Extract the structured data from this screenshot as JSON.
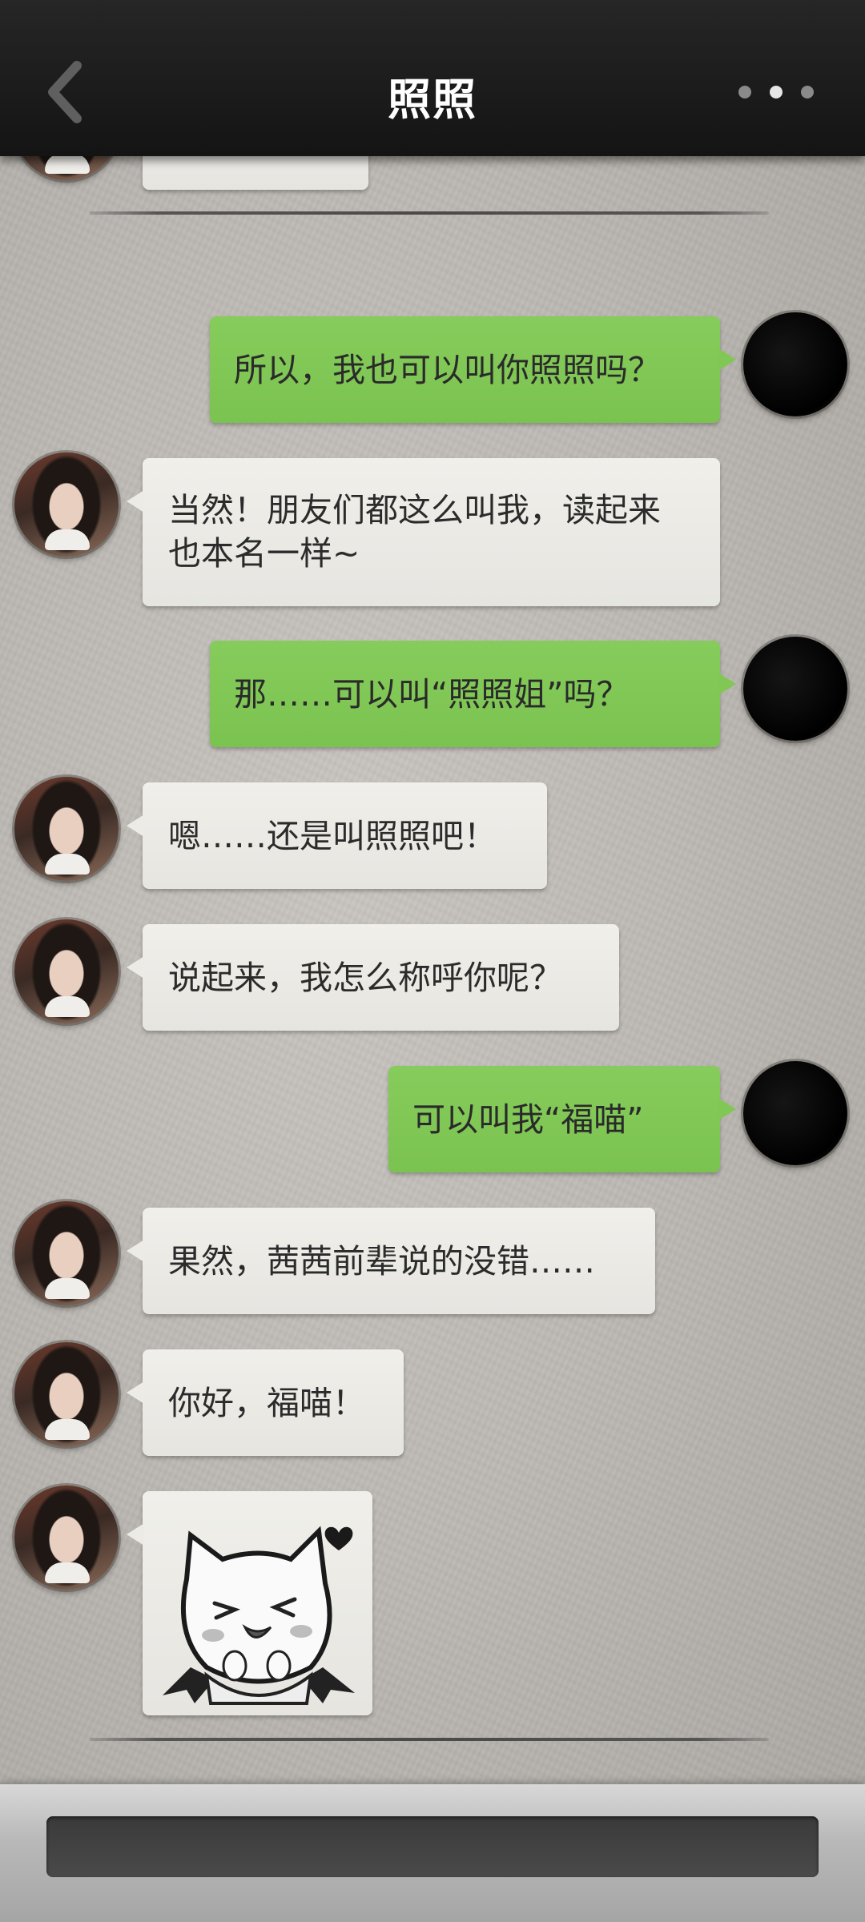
{
  "header": {
    "title": "照照",
    "back_icon": "chevron-left-icon",
    "more_icon": "more-dots-icon"
  },
  "messages": [
    {
      "sender": "her",
      "text": "",
      "partial": true
    },
    {
      "sender": "me",
      "text": "所以，我也可以叫你照照吗？"
    },
    {
      "sender": "her",
      "lines": [
        "当然！朋友们都这么叫我，读起来",
        "也本名一样~"
      ]
    },
    {
      "sender": "me",
      "text": "那……可以叫“照照姐”吗？"
    },
    {
      "sender": "her",
      "text": "嗯……还是叫照照吧！"
    },
    {
      "sender": "her",
      "text": "说起来，我怎么称呼你呢？"
    },
    {
      "sender": "me",
      "text": "可以叫我“福喵”"
    },
    {
      "sender": "her",
      "text": "果然，茜茜前辈说的没错……"
    },
    {
      "sender": "her",
      "text": "你好，福喵！"
    },
    {
      "sender": "her",
      "type": "sticker",
      "sticker": "winking-bat-cat-sticker"
    }
  ],
  "input": {
    "value": "",
    "placeholder": ""
  },
  "colors": {
    "header_bg": "#1c1c1c",
    "my_bubble": "#80c756",
    "her_bubble": "#ecebe6",
    "input_bg": "#424242"
  }
}
